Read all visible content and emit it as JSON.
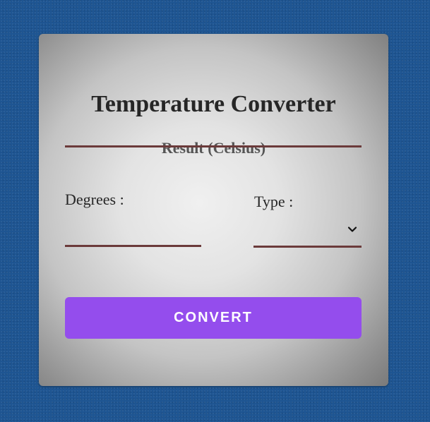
{
  "app": {
    "title": "Temperature Converter"
  },
  "result": {
    "label": "Result (Celsius)",
    "value": ""
  },
  "degrees": {
    "label": "Degrees :",
    "value": "",
    "placeholder": ""
  },
  "type": {
    "label": "Type :",
    "selected": ""
  },
  "convert": {
    "label": "CONVERT"
  },
  "colors": {
    "background": "#1e5592",
    "accent": "#944ded",
    "underline": "#6b3a3a",
    "text": "#262626"
  },
  "icons": {
    "type_dropdown": "chevron-down-icon"
  }
}
